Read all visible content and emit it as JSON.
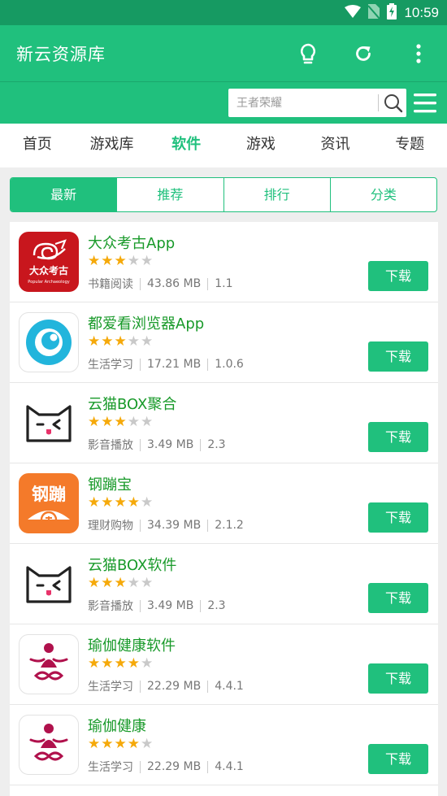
{
  "status_bar": {
    "time": "10:59",
    "icons": [
      "wifi-icon",
      "no-sim-icon",
      "battery-charging-icon"
    ]
  },
  "app_bar": {
    "title": "新云资源库",
    "actions": [
      "lightbulb-icon",
      "refresh-icon",
      "more-vert-icon"
    ]
  },
  "search": {
    "placeholder": "王者荣耀",
    "value": ""
  },
  "tabs": [
    {
      "label": "首页",
      "active": false
    },
    {
      "label": "游戏库",
      "active": false
    },
    {
      "label": "软件",
      "active": true
    },
    {
      "label": "游戏",
      "active": false
    },
    {
      "label": "资讯",
      "active": false
    },
    {
      "label": "专题",
      "active": false
    }
  ],
  "segments": [
    {
      "label": "最新",
      "active": true
    },
    {
      "label": "推荐",
      "active": false
    },
    {
      "label": "排行",
      "active": false
    },
    {
      "label": "分类",
      "active": false
    }
  ],
  "colors": {
    "primary": "#20c07d",
    "status_bar": "#169a62",
    "title_green": "#199a2a",
    "star": "#f5a90a"
  },
  "apps": [
    {
      "name": "大众考古App",
      "rating": 3,
      "category": "书籍阅读",
      "size": "43.86 MB",
      "version": "1.1",
      "icon": "archaeology-logo-icon",
      "icon_text": "大众考古",
      "icon_subtext": "Popular Archaeology",
      "button": "下载"
    },
    {
      "name": "都爱看浏览器App",
      "rating": 3,
      "category": "生活学习",
      "size": "17.21 MB",
      "version": "1.0.6",
      "icon": "browser-logo-icon",
      "button": "下载"
    },
    {
      "name": "云猫BOX聚合",
      "rating": 3,
      "category": "影音播放",
      "size": "3.49 MB",
      "version": "2.3",
      "icon": "cat-box-icon",
      "button": "下载"
    },
    {
      "name": "钢蹦宝",
      "rating": 4,
      "category": "理财购物",
      "size": "34.39 MB",
      "version": "2.1.2",
      "icon": "coin-logo-icon",
      "icon_text": "钢蹦",
      "button": "下载"
    },
    {
      "name": "云猫BOX软件",
      "rating": 3,
      "category": "影音播放",
      "size": "3.49 MB",
      "version": "2.3",
      "icon": "cat-box-icon",
      "button": "下载"
    },
    {
      "name": "瑜伽健康软件",
      "rating": 4,
      "category": "生活学习",
      "size": "22.29 MB",
      "version": "4.4.1",
      "icon": "yoga-logo-icon",
      "button": "下载"
    },
    {
      "name": "瑜伽健康",
      "rating": 4,
      "category": "生活学习",
      "size": "22.29 MB",
      "version": "4.4.1",
      "icon": "yoga-logo-icon",
      "button": "下载"
    }
  ]
}
